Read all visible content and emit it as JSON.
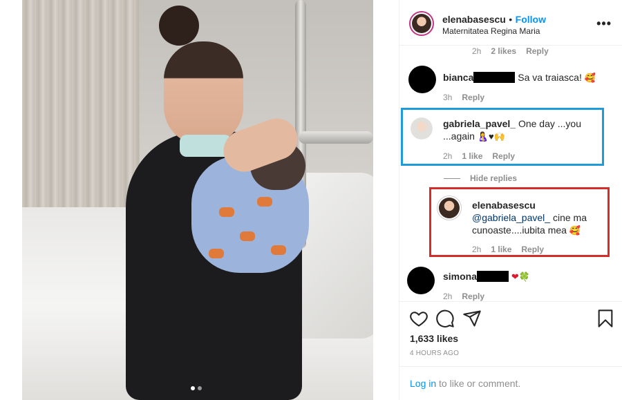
{
  "post": {
    "username": "elenabasescu",
    "separator": "•",
    "follow_label": "Follow",
    "location": "Maternitatea Regina Maria",
    "more_icon": "more-horizontal-icon",
    "photo": {
      "carousel_count": 2,
      "active_index": 0,
      "next_icon": "chevron-right-icon"
    }
  },
  "comments": {
    "partial_top": {
      "time": "2h",
      "likes": "2 likes",
      "reply": "Reply"
    },
    "bianca": {
      "username": "bianca",
      "text": "Sa va traiasca!",
      "emoji": "🥰",
      "time": "3h",
      "reply": "Reply"
    },
    "gabriela": {
      "username": "gabriela_pavel_",
      "text": "One day ...you ...again",
      "emoji": "🤱♥🙌",
      "time": "2h",
      "likes": "1 like",
      "reply": "Reply"
    },
    "hide_replies": "Hide replies",
    "elena_reply": {
      "username": "elenabasescu",
      "mention": "@gabriela_pavel_",
      "text": "cine ma cunoaste....iubita mea",
      "emoji": "🥰",
      "time": "2h",
      "likes": "1 like",
      "reply": "Reply"
    },
    "simona": {
      "username": "simona",
      "emoji": "❤🍀",
      "time": "2h",
      "reply": "Reply"
    }
  },
  "actions": {
    "like_icon": "heart-icon",
    "comment_icon": "comment-icon",
    "share_icon": "share-icon",
    "save_icon": "bookmark-icon",
    "likes_count": "1,633 likes",
    "time_ago": "4 HOURS AGO"
  },
  "footer": {
    "login_link": "Log in",
    "login_text": " to like or comment."
  },
  "colors": {
    "accent": "#0095f6",
    "blue_highlight": "#1f9bd7",
    "red_highlight": "#d52b2b",
    "muted": "#8e8e8e"
  }
}
